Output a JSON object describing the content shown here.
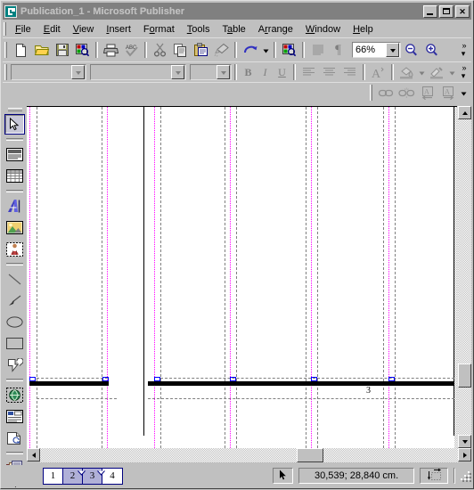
{
  "window": {
    "title": "Publication_1 - Microsoft Publisher",
    "app_icon": "publisher-icon",
    "minimize_label": "",
    "maximize_label": "",
    "close_label": "✕"
  },
  "menu": {
    "items": [
      {
        "label": "File",
        "accel": "F"
      },
      {
        "label": "Edit",
        "accel": "E"
      },
      {
        "label": "View",
        "accel": "V"
      },
      {
        "label": "Insert",
        "accel": "I"
      },
      {
        "label": "Format",
        "accel": "o"
      },
      {
        "label": "Tools",
        "accel": "T"
      },
      {
        "label": "Table",
        "accel": "a"
      },
      {
        "label": "Arrange",
        "accel": "r"
      },
      {
        "label": "Window",
        "accel": "W"
      },
      {
        "label": "Help",
        "accel": "H"
      }
    ]
  },
  "standard_toolbar": {
    "buttons": [
      {
        "name": "new-publication-button",
        "title": "New"
      },
      {
        "name": "open-button",
        "title": "Open"
      },
      {
        "name": "save-button",
        "title": "Save"
      },
      {
        "name": "search-web-button",
        "title": "Publish to Web"
      },
      {
        "name": "print-button",
        "title": "Print"
      },
      {
        "name": "spelling-button",
        "title": "Spelling"
      },
      {
        "name": "cut-button",
        "title": "Cut"
      },
      {
        "name": "copy-button",
        "title": "Copy"
      },
      {
        "name": "paste-button",
        "title": "Paste"
      },
      {
        "name": "format-painter-button",
        "title": "Format Painter"
      },
      {
        "name": "undo-button",
        "title": "Undo"
      },
      {
        "name": "undo-dropdown-button",
        "title": "Undo history"
      },
      {
        "name": "design-gallery-button",
        "title": "Design Gallery Object"
      },
      {
        "name": "show-special-characters-button",
        "title": "Special Characters"
      },
      {
        "name": "paragraph-marks-button",
        "title": "Show Formatting"
      }
    ],
    "zoom_value": "66%",
    "zoom_out_name": "zoom-out-button",
    "zoom_in_name": "zoom-in-button",
    "overflow_label": "»"
  },
  "formatting_toolbar": {
    "font_name": "",
    "font_name_placeholder": "",
    "style_name": "",
    "font_size": "",
    "bold_label": "B",
    "italic_label": "I",
    "underline_label": "U",
    "align_left_name": "align-left-button",
    "align_center_name": "align-center-button",
    "align_right_name": "align-right-button",
    "font_scheme_label": "A",
    "fill_color_name": "fill-color-button",
    "line_color_name": "line-color-button",
    "overflow_label": "»"
  },
  "connect_toolbar": {
    "buttons": [
      {
        "name": "connect-text-boxes-button",
        "title": "Connect Text Boxes"
      },
      {
        "name": "disconnect-text-boxes-button",
        "title": "Disconnect Text Boxes"
      },
      {
        "name": "go-to-previous-text-box-button",
        "title": "Go to Previous Text Box"
      },
      {
        "name": "go-to-next-text-box-button",
        "title": "Go to Next Text Box"
      }
    ],
    "overflow_label": "▾"
  },
  "toolbox": {
    "tools": [
      {
        "name": "select-objects-tool",
        "title": "Select Objects",
        "selected": true
      },
      {
        "name": "text-box-tool",
        "title": "Text Box",
        "selected": false
      },
      {
        "name": "insert-table-tool",
        "title": "Insert Table",
        "selected": false
      },
      {
        "name": "wordart-tool",
        "title": "Insert WordArt",
        "selected": false
      },
      {
        "name": "picture-frame-tool",
        "title": "Picture Frame",
        "selected": false
      },
      {
        "name": "clip-gallery-tool",
        "title": "Clip Gallery Tool",
        "selected": false
      },
      {
        "name": "line-tool",
        "title": "Line",
        "selected": false
      },
      {
        "name": "arrow-tool",
        "title": "Arrow",
        "selected": false
      },
      {
        "name": "oval-tool",
        "title": "Oval",
        "selected": false
      },
      {
        "name": "rectangle-tool",
        "title": "Rectangle",
        "selected": false
      },
      {
        "name": "custom-shapes-tool",
        "title": "Custom Shapes",
        "selected": false
      },
      {
        "name": "hot-spot-tool",
        "title": "Hot Spot",
        "selected": false
      },
      {
        "name": "form-control-tool",
        "title": "Form Control",
        "selected": false
      },
      {
        "name": "html-code-fragment-tool",
        "title": "HTML Code Fragment",
        "selected": false
      },
      {
        "name": "design-gallery-tool",
        "title": "Design Gallery Object",
        "selected": false
      }
    ]
  },
  "canvas": {
    "page_number_label": "3",
    "guide_color_margin": "#ff00ff",
    "guide_color_frame": "#808080",
    "handle_color": "#0000ff",
    "rule_bar_color": "#000000"
  },
  "scrollbars": {
    "vertical_up_name": "scroll-up-button",
    "vertical_down_name": "scroll-down-button",
    "horizontal_left_name": "scroll-left-button",
    "horizontal_right_name": "scroll-right-button"
  },
  "status_bar": {
    "pages": [
      {
        "label": "1",
        "active": false
      },
      {
        "label": "2",
        "active": true
      },
      {
        "label": "3",
        "active": true
      },
      {
        "label": "4",
        "active": false
      }
    ],
    "pointer_icon": "mouse-pointer-icon",
    "coordinates": "30,539; 28,840 cm.",
    "object_size_icon": "object-size-icon",
    "resize_grip": "resize-grip"
  }
}
